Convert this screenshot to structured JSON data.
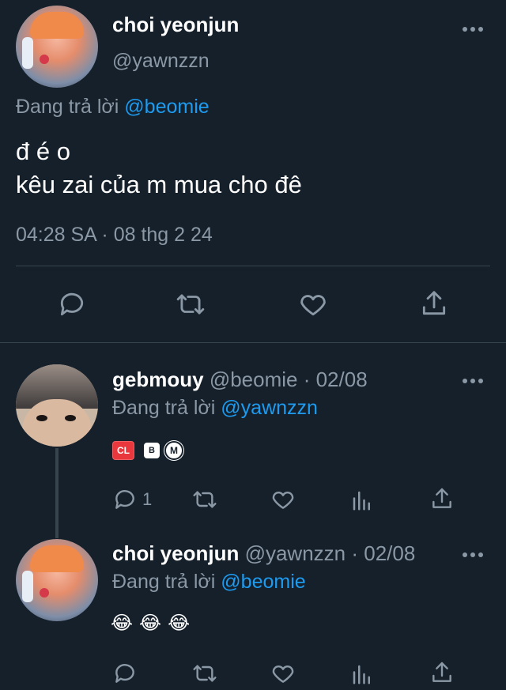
{
  "main_tweet": {
    "display_name": "choi yeonjun",
    "handle": "@yawnzzn",
    "replying_label": "Đang trả lời",
    "replying_to": "@beomie",
    "text_line1": "đ é o",
    "text_line2": "kêu zai của m mua cho đê",
    "timestamp": "04:28 SA · 08 thg 2 24"
  },
  "reply1": {
    "display_name": "gebmouy",
    "handle": "@beomie",
    "date": "· 02/08",
    "replying_label": "Đang trả lời",
    "replying_to": "@yawnzzn",
    "badge_cl": "CL",
    "badge_b": "B",
    "badge_m": "M",
    "reply_count": "1"
  },
  "reply2": {
    "display_name": "choi yeonjun",
    "handle": "@yawnzzn",
    "date": "· 02/08",
    "replying_label": "Đang trả lời",
    "replying_to": "@beomie",
    "emojis": [
      "😂",
      "😂",
      "😂"
    ]
  },
  "colors": {
    "background": "#15202b",
    "accent": "#1d9bf0",
    "muted": "#8b98a5",
    "divider": "#38444d"
  },
  "icons": {
    "more": "more-dots-icon",
    "reply": "reply-icon",
    "retweet": "retweet-icon",
    "like": "heart-icon",
    "share": "share-icon",
    "views": "analytics-icon"
  }
}
